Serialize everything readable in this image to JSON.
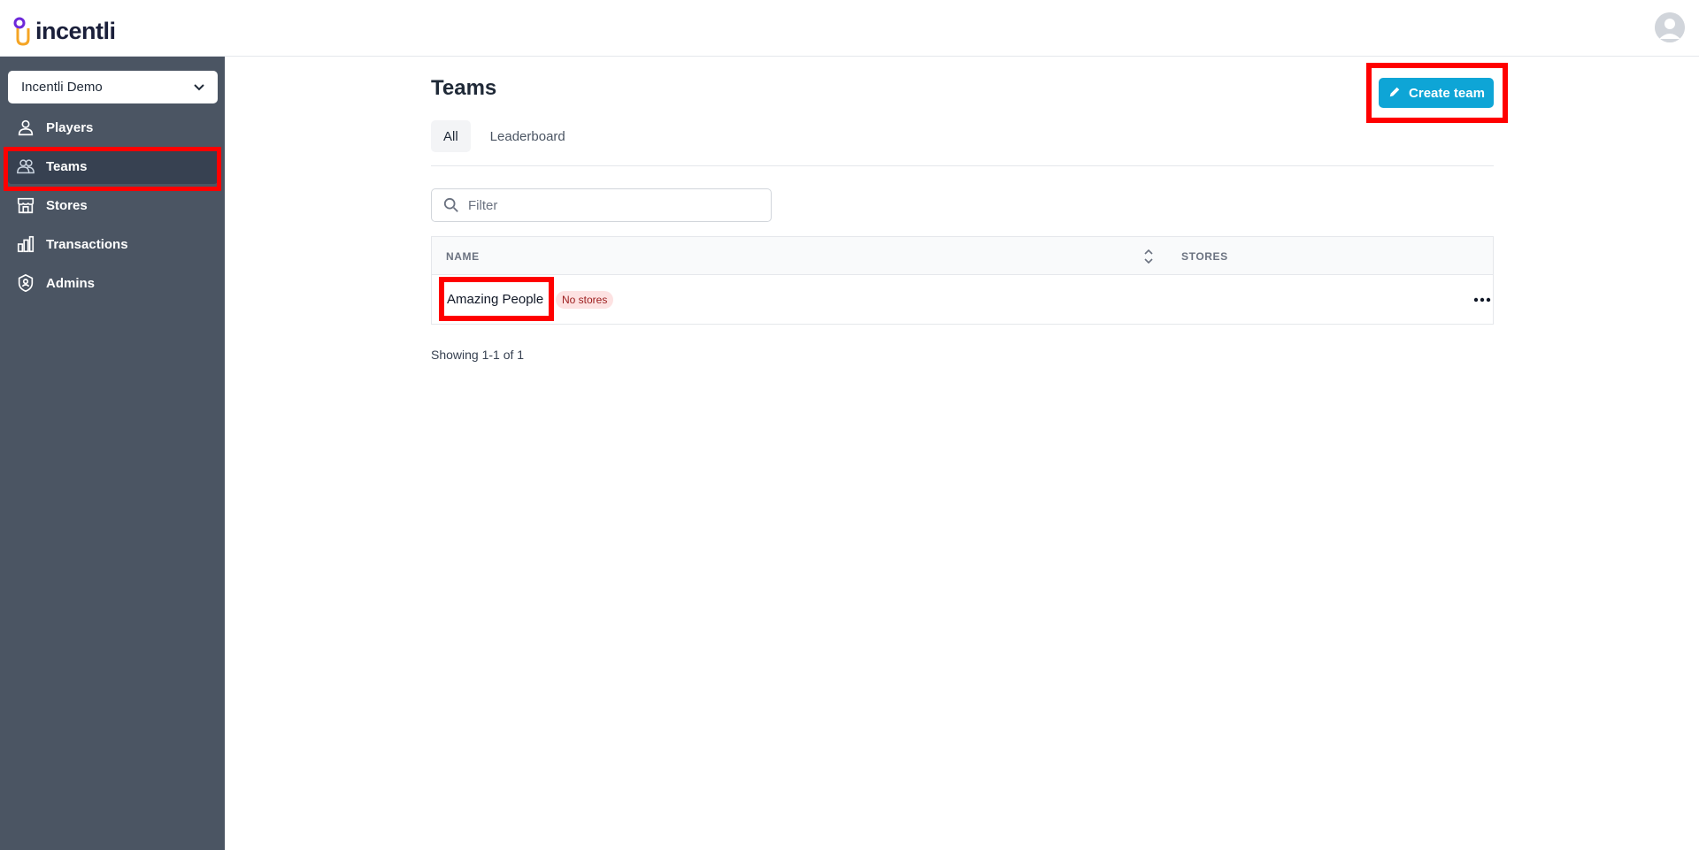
{
  "app": {
    "logo_text": "incentli",
    "colors": {
      "sidebar": "#4b5563",
      "sidebar_active": "#374151",
      "accent": "#0ea5d6",
      "highlight": "#ff0000",
      "badge_bg": "#fde2e2",
      "badge_text": "#9b1c1c"
    }
  },
  "sidebar": {
    "org_select": {
      "value": "Incentli Demo",
      "icon": "chevron-down-icon"
    },
    "items": [
      {
        "label": "Players",
        "icon": "user-icon",
        "active": false
      },
      {
        "label": "Teams",
        "icon": "users-icon",
        "active": true
      },
      {
        "label": "Stores",
        "icon": "store-icon",
        "active": false
      },
      {
        "label": "Transactions",
        "icon": "chart-bar-icon",
        "active": false
      },
      {
        "label": "Admins",
        "icon": "shield-user-icon",
        "active": false
      }
    ]
  },
  "main": {
    "title": "Teams",
    "create_button": {
      "label": "Create team",
      "icon": "pencil-icon"
    },
    "tabs": [
      {
        "label": "All",
        "active": true
      },
      {
        "label": "Leaderboard",
        "active": false
      }
    ],
    "filter": {
      "placeholder": "Filter",
      "value": ""
    },
    "table": {
      "columns": [
        "NAME",
        "STORES"
      ],
      "rows": [
        {
          "name": "Amazing People",
          "badge": "No stores"
        }
      ]
    },
    "showing": "Showing 1-1 of 1"
  }
}
